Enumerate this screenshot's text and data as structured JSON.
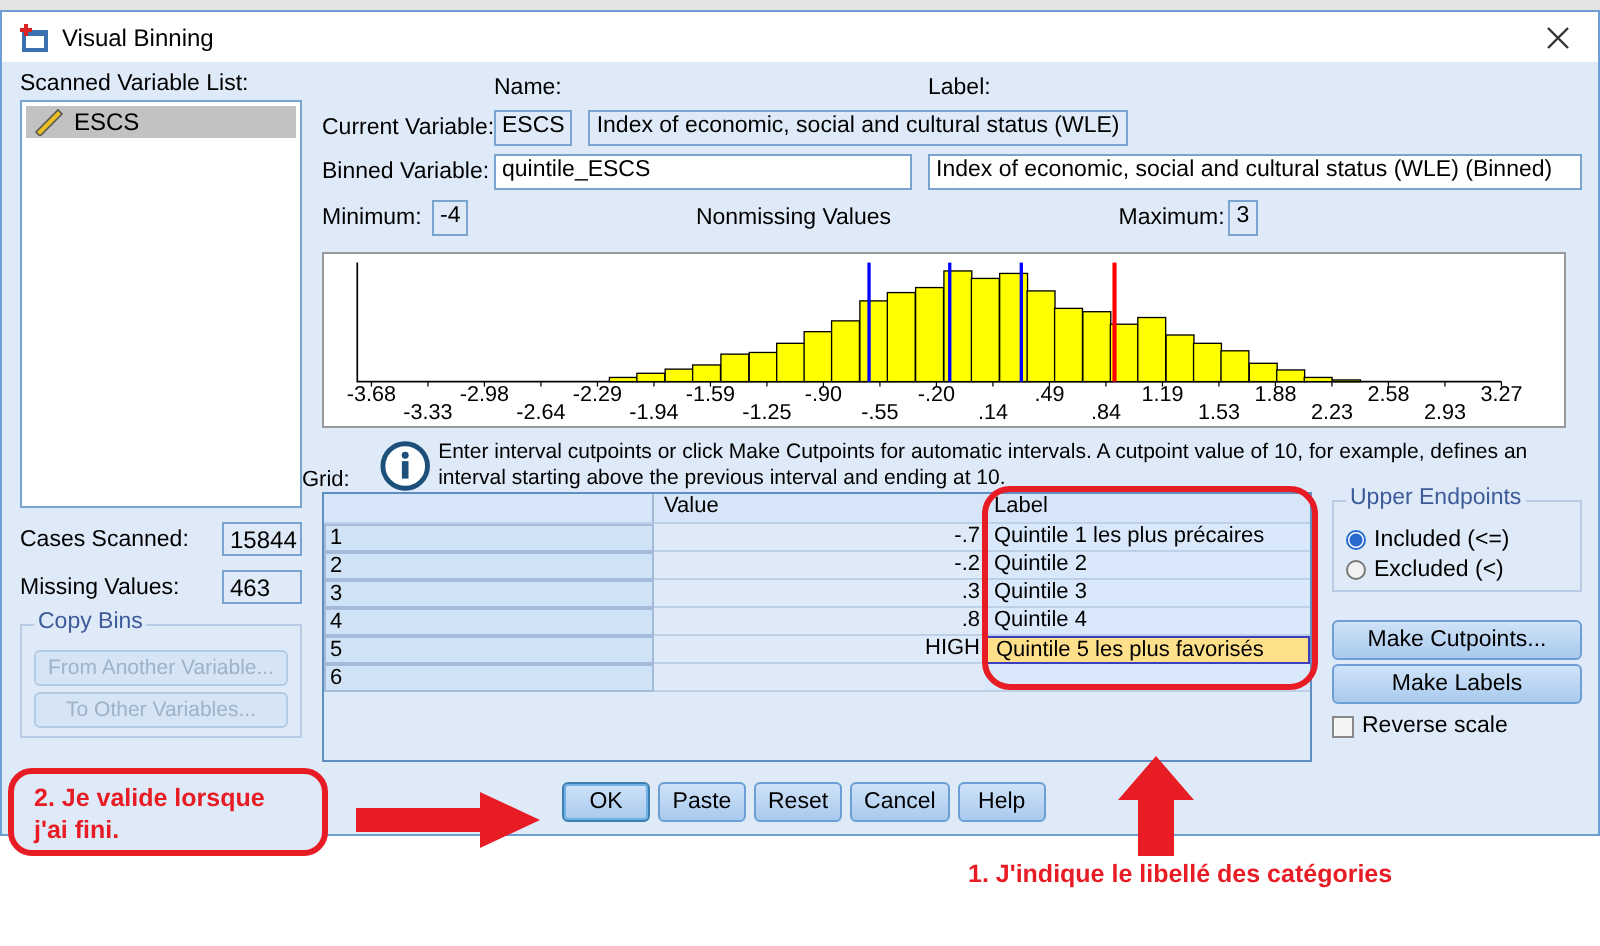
{
  "window": {
    "title": "Visual Binning"
  },
  "scanned_list": {
    "label": "Scanned Variable List:",
    "items": [
      {
        "name": "ESCS",
        "selected": true
      }
    ]
  },
  "cases_scanned": {
    "label": "Cases Scanned:",
    "value": "15844"
  },
  "missing_values": {
    "label": "Missing Values:",
    "value": "463"
  },
  "copy_bins": {
    "title": "Copy Bins",
    "buttons": [
      {
        "label": "From Another Variable...",
        "disabled": true
      },
      {
        "label": "To Other Variables...",
        "disabled": true
      }
    ]
  },
  "headers": {
    "name": "Name:",
    "label": "Label:"
  },
  "current_variable": {
    "label": "Current Variable:",
    "name": "ESCS",
    "var_label": "Index of economic, social and cultural status (WLE)"
  },
  "binned_variable": {
    "label": "Binned Variable:",
    "name": "quintile_ESCS",
    "var_label": "Index of economic, social and cultural status (WLE) (Binned)"
  },
  "minimum": {
    "label": "Minimum:",
    "value": "-4"
  },
  "nonmissing": "Nonmissing Values",
  "maximum": {
    "label": "Maximum:",
    "value": "3"
  },
  "histogram": {
    "x_tick_labels": [
      "-3.68",
      "-3.33",
      "-2.98",
      "-2.64",
      "-2.29",
      "-1.94",
      "-1.59",
      "-1.25",
      "-.90",
      "-.55",
      "-.20",
      ".14",
      ".49",
      ".84",
      "1.19",
      "1.53",
      "1.88",
      "2.23",
      "2.58",
      "2.93",
      "3.27"
    ]
  },
  "info": "Enter interval cutpoints or click Make Cutpoints for automatic intervals. A cutpoint value of 10, for example, defines an interval starting above the previous interval and ending at 10.",
  "grid": {
    "label": "Grid:",
    "columns": [
      "Value",
      "Label"
    ],
    "rows": [
      {
        "index": "1",
        "value": "-.7",
        "bin_label": "Quintile 1 les plus précaires",
        "selected": false
      },
      {
        "index": "2",
        "value": "-.2",
        "bin_label": "Quintile 2",
        "selected": false
      },
      {
        "index": "3",
        "value": ".3",
        "bin_label": "Quintile 3",
        "selected": false
      },
      {
        "index": "4",
        "value": ".8",
        "bin_label": "Quintile 4",
        "selected": false
      },
      {
        "index": "5",
        "value": "HIGH",
        "bin_label": "Quintile 5 les plus favorisés",
        "selected": true
      },
      {
        "index": "6",
        "selected": false
      }
    ]
  },
  "upper_endpoints": {
    "title": "Upper Endpoints",
    "options": [
      {
        "label": "Included (<=)",
        "selected": true
      },
      {
        "label": "Excluded (<)",
        "selected": false
      }
    ]
  },
  "side_buttons": [
    "Make Cutpoints...",
    "Make Labels"
  ],
  "reverse_scale": {
    "label": "Reverse scale",
    "checked": false
  },
  "buttons": [
    {
      "label": "OK",
      "default": true
    },
    {
      "label": "Paste",
      "default": false
    },
    {
      "label": "Reset",
      "default": false
    },
    {
      "label": "Cancel",
      "default": false
    },
    {
      "label": "Help",
      "default": false
    }
  ],
  "annotations": [
    {
      "text": "2. Je valide lorsque j'ai fini."
    },
    {
      "text": "1. J'indique le libellé des catégories"
    }
  ]
}
